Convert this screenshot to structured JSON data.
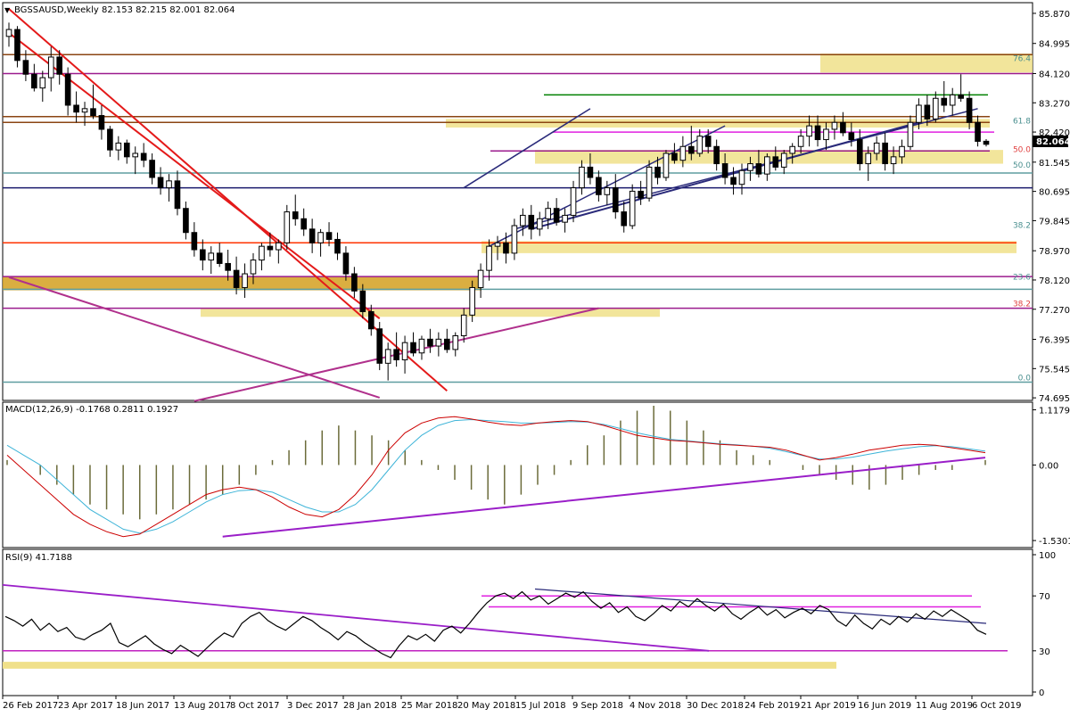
{
  "chart_data": {
    "type": "candlestick",
    "symbol_header": "BGSSAUSD,Weekly  82.153 82.215 82.001 82.064",
    "last_price_label": "82.064",
    "x_tick_labels": [
      "26 Feb 2017",
      "23 Apr 2017",
      "18 Jun 2017",
      "13 Aug 2017",
      "8 Oct 2017",
      "3 Dec 2017",
      "28 Jan 2018",
      "25 Mar 2018",
      "20 May 2018",
      "15 Jul 2018",
      "9 Sep 2018",
      "4 Nov 2018",
      "30 Dec 2018",
      "24 Feb 2019",
      "21 Apr 2019",
      "16 Jun 2019",
      "11 Aug 2019",
      "6 Oct 2019"
    ],
    "price_panel": {
      "y_ticks": [
        85.87,
        84.995,
        84.12,
        83.27,
        82.42,
        81.545,
        80.695,
        79.845,
        78.97,
        78.12,
        77.27,
        76.395,
        75.545,
        74.695
      ],
      "y_tick_labels": [
        "85.870",
        "84.995",
        "84.120",
        "83.270",
        "82.420",
        "81.545",
        "80.695",
        "79.845",
        "78.970",
        "78.120",
        "77.270",
        "76.395",
        "75.545",
        "74.695"
      ],
      "ylim": [
        74.62,
        86.18
      ],
      "candles_ohlc": [
        [
          85.2,
          85.6,
          84.9,
          85.4
        ],
        [
          85.4,
          85.5,
          84.3,
          84.5
        ],
        [
          84.5,
          84.8,
          83.9,
          84.1
        ],
        [
          84.1,
          84.4,
          83.6,
          83.7
        ],
        [
          83.7,
          84.2,
          83.3,
          84.0
        ],
        [
          84.0,
          84.9,
          83.6,
          84.6
        ],
        [
          84.6,
          84.8,
          83.8,
          84.1
        ],
        [
          84.1,
          84.3,
          82.9,
          83.2
        ],
        [
          83.2,
          83.6,
          82.7,
          83.0
        ],
        [
          83.0,
          83.3,
          82.6,
          83.1
        ],
        [
          83.1,
          83.8,
          82.8,
          82.9
        ],
        [
          82.9,
          83.2,
          82.2,
          82.5
        ],
        [
          82.5,
          82.6,
          81.7,
          81.9
        ],
        [
          81.9,
          82.3,
          81.6,
          82.1
        ],
        [
          82.1,
          82.2,
          81.5,
          81.7
        ],
        [
          81.7,
          82.0,
          81.2,
          81.8
        ],
        [
          81.8,
          82.1,
          81.4,
          81.6
        ],
        [
          81.6,
          81.8,
          80.9,
          81.1
        ],
        [
          81.1,
          81.4,
          80.6,
          80.8
        ],
        [
          80.8,
          81.2,
          80.4,
          81.0
        ],
        [
          81.0,
          81.3,
          80.0,
          80.2
        ],
        [
          80.2,
          80.4,
          79.3,
          79.5
        ],
        [
          79.5,
          79.8,
          78.8,
          79.0
        ],
        [
          79.0,
          79.3,
          78.4,
          78.7
        ],
        [
          78.7,
          79.1,
          78.3,
          78.9
        ],
        [
          78.9,
          79.2,
          78.5,
          78.6
        ],
        [
          78.6,
          79.0,
          78.1,
          78.4
        ],
        [
          78.4,
          78.8,
          77.7,
          77.9
        ],
        [
          77.9,
          78.6,
          77.6,
          78.3
        ],
        [
          78.3,
          78.9,
          78.0,
          78.7
        ],
        [
          78.7,
          79.2,
          78.4,
          79.1
        ],
        [
          79.1,
          79.5,
          78.8,
          79.0
        ],
        [
          79.0,
          79.3,
          78.6,
          79.2
        ],
        [
          79.2,
          80.3,
          79.0,
          80.1
        ],
        [
          80.1,
          80.6,
          79.7,
          79.9
        ],
        [
          79.9,
          80.2,
          79.4,
          79.6
        ],
        [
          79.6,
          79.9,
          78.9,
          79.2
        ],
        [
          79.2,
          79.6,
          78.8,
          79.5
        ],
        [
          79.5,
          79.8,
          79.1,
          79.3
        ],
        [
          79.3,
          79.5,
          78.7,
          78.9
        ],
        [
          78.9,
          79.1,
          78.1,
          78.3
        ],
        [
          78.3,
          78.5,
          77.6,
          77.8
        ],
        [
          77.8,
          78.0,
          77.0,
          77.2
        ],
        [
          77.2,
          77.4,
          76.5,
          76.7
        ],
        [
          76.7,
          76.9,
          75.5,
          75.7
        ],
        [
          75.7,
          76.3,
          75.2,
          76.1
        ],
        [
          76.1,
          76.6,
          75.6,
          75.8
        ],
        [
          75.8,
          76.5,
          75.4,
          76.3
        ],
        [
          76.3,
          76.6,
          75.9,
          76.0
        ],
        [
          76.0,
          76.5,
          75.8,
          76.4
        ],
        [
          76.4,
          76.7,
          76.0,
          76.2
        ],
        [
          76.2,
          76.6,
          75.9,
          76.4
        ],
        [
          76.4,
          76.7,
          76.0,
          76.1
        ],
        [
          76.1,
          76.6,
          75.9,
          76.5
        ],
        [
          76.5,
          77.3,
          76.3,
          77.1
        ],
        [
          77.1,
          78.1,
          76.9,
          77.9
        ],
        [
          77.9,
          78.6,
          77.6,
          78.4
        ],
        [
          78.4,
          79.3,
          78.1,
          79.1
        ],
        [
          79.1,
          79.4,
          78.7,
          79.2
        ],
        [
          79.2,
          79.5,
          78.6,
          78.9
        ],
        [
          78.9,
          79.9,
          78.7,
          79.7
        ],
        [
          79.7,
          80.2,
          79.4,
          80.0
        ],
        [
          80.0,
          80.3,
          79.3,
          79.6
        ],
        [
          79.6,
          80.1,
          79.4,
          79.9
        ],
        [
          79.9,
          80.4,
          79.6,
          80.2
        ],
        [
          80.2,
          80.5,
          79.7,
          79.8
        ],
        [
          79.8,
          80.2,
          79.5,
          80.0
        ],
        [
          80.0,
          81.0,
          79.8,
          80.8
        ],
        [
          80.8,
          81.6,
          80.6,
          81.4
        ],
        [
          81.4,
          81.8,
          80.9,
          81.1
        ],
        [
          81.1,
          81.3,
          80.4,
          80.6
        ],
        [
          80.6,
          81.0,
          80.3,
          80.8
        ],
        [
          80.8,
          81.2,
          79.9,
          80.1
        ],
        [
          80.1,
          80.4,
          79.5,
          79.7
        ],
        [
          79.7,
          80.9,
          79.6,
          80.7
        ],
        [
          80.7,
          81.0,
          80.3,
          80.5
        ],
        [
          80.5,
          81.6,
          80.4,
          81.4
        ],
        [
          81.4,
          81.7,
          80.9,
          81.1
        ],
        [
          81.1,
          81.9,
          81.0,
          81.8
        ],
        [
          81.8,
          82.1,
          81.5,
          81.6
        ],
        [
          81.6,
          82.3,
          81.4,
          82.0
        ],
        [
          82.0,
          82.6,
          81.6,
          81.8
        ],
        [
          81.8,
          82.5,
          81.7,
          82.3
        ],
        [
          82.3,
          82.5,
          81.8,
          82.0
        ],
        [
          82.0,
          82.2,
          81.3,
          81.5
        ],
        [
          81.5,
          81.8,
          80.9,
          81.1
        ],
        [
          81.1,
          81.4,
          80.6,
          80.9
        ],
        [
          80.9,
          81.5,
          80.6,
          81.3
        ],
        [
          81.3,
          81.7,
          81.0,
          81.5
        ],
        [
          81.5,
          81.9,
          81.1,
          81.2
        ],
        [
          81.2,
          81.8,
          81.0,
          81.7
        ],
        [
          81.7,
          82.0,
          81.3,
          81.4
        ],
        [
          81.4,
          81.9,
          81.2,
          81.8
        ],
        [
          81.8,
          82.1,
          81.5,
          82.0
        ],
        [
          82.0,
          82.5,
          81.8,
          82.3
        ],
        [
          82.3,
          82.9,
          82.0,
          82.6
        ],
        [
          82.6,
          82.9,
          82.0,
          82.2
        ],
        [
          82.2,
          82.7,
          81.9,
          82.5
        ],
        [
          82.5,
          82.9,
          82.2,
          82.7
        ],
        [
          82.7,
          83.0,
          82.3,
          82.4
        ],
        [
          82.4,
          82.7,
          82.0,
          82.2
        ],
        [
          82.2,
          82.5,
          81.3,
          81.5
        ],
        [
          81.5,
          82.0,
          81.0,
          81.8
        ],
        [
          81.8,
          82.3,
          81.6,
          82.1
        ],
        [
          82.1,
          82.4,
          81.3,
          81.5
        ],
        [
          81.5,
          82.0,
          81.2,
          81.7
        ],
        [
          81.7,
          82.2,
          81.5,
          82.0
        ],
        [
          82.0,
          82.9,
          81.9,
          82.7
        ],
        [
          82.7,
          83.4,
          82.5,
          83.2
        ],
        [
          83.2,
          83.5,
          82.6,
          82.8
        ],
        [
          82.8,
          83.6,
          82.7,
          83.4
        ],
        [
          83.4,
          83.9,
          83.0,
          83.2
        ],
        [
          83.2,
          83.7,
          82.9,
          83.5
        ],
        [
          83.5,
          84.1,
          83.3,
          83.4
        ],
        [
          83.4,
          83.6,
          82.5,
          82.7
        ],
        [
          82.7,
          82.9,
          82.0,
          82.15
        ],
        [
          82.153,
          82.215,
          82.001,
          82.064
        ]
      ],
      "horizontal_levels": [
        {
          "value": 84.67,
          "color": "#8B4513"
        },
        {
          "value": 84.12,
          "color": "#9B1B8E"
        },
        {
          "value": 83.5,
          "color": "#008000"
        },
        {
          "value": 82.87,
          "color": "#8B4513"
        },
        {
          "value": 82.7,
          "color": "#8B4513"
        },
        {
          "value": 82.42,
          "color": "#E020E0"
        },
        {
          "value": 81.87,
          "color": "#9B1B8E"
        },
        {
          "value": 81.23,
          "color": "#5F9EA0"
        },
        {
          "value": 80.8,
          "color": "#1A1A6E"
        },
        {
          "value": 79.2,
          "color": "#FF3300"
        },
        {
          "value": 78.22,
          "color": "#9B1B8E"
        },
        {
          "value": 77.85,
          "color": "#5F9EA0"
        },
        {
          "value": 77.3,
          "color": "#9B1B8E"
        },
        {
          "value": 75.15,
          "color": "#5F9EA0"
        }
      ],
      "fib_labels": [
        "76.4",
        "61.8",
        "50.0",
        "50.0",
        "38.2",
        "23.6",
        "38.2",
        "0.0"
      ],
      "fib_values": [
        84.43,
        82.62,
        81.79,
        81.33,
        79.59,
        78.08,
        77.3,
        75.15
      ],
      "zones": [
        {
          "from": 84.15,
          "to": 84.7,
          "color": "#F0E08A"
        },
        {
          "from": 82.55,
          "to": 82.8,
          "color": "#F0E08A"
        },
        {
          "from": 81.5,
          "to": 81.9,
          "color": "#F0E08A"
        },
        {
          "from": 78.9,
          "to": 79.25,
          "color": "#F0E08A"
        },
        {
          "from": 77.82,
          "to": 78.22,
          "color": "#D4A020"
        },
        {
          "from": 77.05,
          "to": 77.3,
          "color": "#F0E08A"
        }
      ]
    },
    "macd_panel": {
      "label": "MACD(12,26,9) -0.1768 0.2811 0.1927",
      "y_tick_labels": [
        "1.1179",
        "0.00",
        "-1.5301"
      ],
      "y_ticks": [
        1.1179,
        0.0,
        -1.5301
      ],
      "ylim": [
        -1.6,
        1.2
      ],
      "histogram": [
        0.1,
        0.0,
        -0.2,
        -0.4,
        -0.6,
        -0.8,
        -0.9,
        -1.0,
        -1.1,
        -1.0,
        -0.9,
        -0.8,
        -0.7,
        -0.6,
        -0.4,
        -0.2,
        0.1,
        0.3,
        0.5,
        0.7,
        0.8,
        0.7,
        0.6,
        0.5,
        0.3,
        0.1,
        -0.1,
        -0.3,
        -0.5,
        -0.7,
        -0.8,
        -0.6,
        -0.4,
        -0.2,
        0.1,
        0.4,
        0.6,
        0.9,
        1.1,
        1.2,
        1.1,
        0.9,
        0.7,
        0.5,
        0.3,
        0.2,
        0.1,
        0.0,
        -0.1,
        -0.2,
        -0.3,
        -0.4,
        -0.5,
        -0.4,
        -0.3,
        -0.2,
        -0.1,
        -0.1,
        0.0,
        0.1
      ],
      "macd_line": [
        0.2,
        -0.1,
        -0.4,
        -0.7,
        -1.0,
        -1.2,
        -1.35,
        -1.45,
        -1.4,
        -1.2,
        -1.0,
        -0.8,
        -0.6,
        -0.5,
        -0.45,
        -0.5,
        -0.65,
        -0.85,
        -1.0,
        -1.05,
        -0.9,
        -0.6,
        -0.2,
        0.3,
        0.65,
        0.85,
        0.95,
        0.98,
        0.93,
        0.87,
        0.82,
        0.8,
        0.85,
        0.88,
        0.9,
        0.88,
        0.8,
        0.7,
        0.6,
        0.55,
        0.5,
        0.48,
        0.45,
        0.42,
        0.4,
        0.38,
        0.36,
        0.3,
        0.2,
        0.1,
        0.15,
        0.22,
        0.3,
        0.35,
        0.4,
        0.42,
        0.4,
        0.35,
        0.3,
        0.25
      ],
      "signal_line": [
        0.4,
        0.2,
        0.0,
        -0.3,
        -0.6,
        -0.9,
        -1.1,
        -1.3,
        -1.38,
        -1.3,
        -1.15,
        -0.95,
        -0.75,
        -0.6,
        -0.52,
        -0.5,
        -0.55,
        -0.7,
        -0.85,
        -0.95,
        -0.95,
        -0.8,
        -0.5,
        -0.1,
        0.3,
        0.6,
        0.8,
        0.9,
        0.92,
        0.9,
        0.88,
        0.85,
        0.85,
        0.86,
        0.88,
        0.87,
        0.82,
        0.74,
        0.65,
        0.58,
        0.52,
        0.49,
        0.46,
        0.43,
        0.41,
        0.38,
        0.34,
        0.27,
        0.19,
        0.12,
        0.12,
        0.16,
        0.22,
        0.28,
        0.33,
        0.37,
        0.39,
        0.37,
        0.33,
        0.28
      ]
    },
    "rsi_panel": {
      "label": "RSI(9) 41.7188",
      "y_tick_labels": [
        "100",
        "70",
        "30",
        "0"
      ],
      "y_ticks": [
        100,
        70,
        30,
        0
      ],
      "ylim": [
        0,
        100
      ],
      "values": [
        55,
        52,
        48,
        53,
        45,
        50,
        44,
        47,
        40,
        38,
        42,
        45,
        50,
        36,
        33,
        37,
        41,
        35,
        31,
        28,
        34,
        30,
        26,
        32,
        38,
        43,
        40,
        50,
        55,
        58,
        52,
        48,
        45,
        50,
        55,
        52,
        47,
        43,
        38,
        44,
        41,
        36,
        32,
        28,
        25,
        34,
        41,
        38,
        42,
        37,
        45,
        48,
        43,
        50,
        58,
        65,
        70,
        72,
        68,
        73,
        67,
        70,
        64,
        68,
        72,
        69,
        73,
        66,
        61,
        65,
        58,
        62,
        55,
        52,
        57,
        63,
        59,
        66,
        62,
        68,
        63,
        59,
        64,
        57,
        53,
        58,
        62,
        56,
        60,
        54,
        58,
        61,
        57,
        63,
        60,
        52,
        48,
        56,
        50,
        46,
        53,
        49,
        55,
        51,
        57,
        53,
        59,
        55,
        60,
        56,
        52,
        45,
        42
      ],
      "hlines": [
        {
          "value": 70,
          "color": "#E020E0"
        },
        {
          "value": 62,
          "color": "#E020E0"
        },
        {
          "value": 30,
          "color": "#C020C0"
        }
      ],
      "zone": {
        "from": 17,
        "to": 22,
        "color": "#F0E08A"
      }
    },
    "colors": {
      "bull_candle": "#FFFFFF",
      "bear_candle": "#000000",
      "trend_red": "#E41A1A",
      "trend_magenta": "#B0308C",
      "trend_navy": "#2A2A7A",
      "macd_histogram": "#6B6B3A",
      "macd_line": "#CC0000",
      "signal_line": "#3EB4D8",
      "rsi_line": "#000000",
      "purple_trend": "#9A1EC8"
    }
  }
}
